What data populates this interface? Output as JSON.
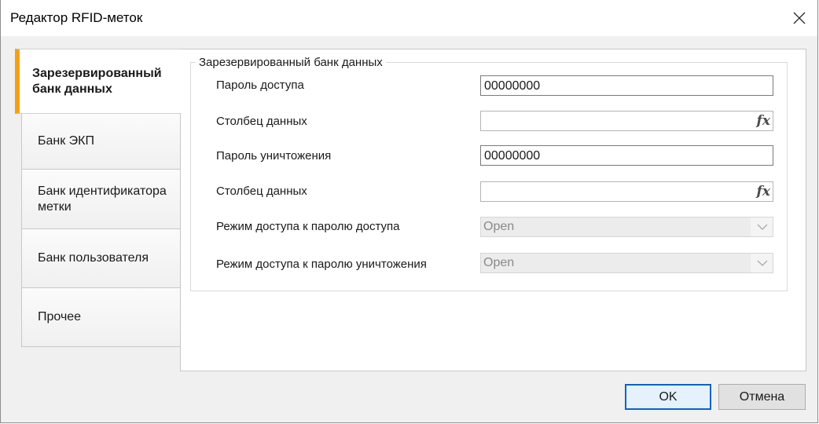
{
  "window": {
    "title": "Редактор RFID-меток"
  },
  "tabs": [
    {
      "label": "Зарезервированный банк данных",
      "active": true
    },
    {
      "label": "Банк ЭКП",
      "active": false
    },
    {
      "label": "Банк идентификатора метки",
      "active": false
    },
    {
      "label": "Банк пользователя",
      "active": false
    },
    {
      "label": "Прочее",
      "active": false
    }
  ],
  "group": {
    "title": "Зарезервированный банк данных",
    "rows": [
      {
        "label": "Пароль доступа",
        "value": "00000000"
      },
      {
        "label": "Столбец данных",
        "value": "",
        "icon": "fx-expression-icon"
      },
      {
        "label": "Пароль уничтожения",
        "value": "00000000"
      },
      {
        "label": "Столбец данных",
        "value": "",
        "icon": "fx-expression-icon"
      },
      {
        "label": "Режим доступа к паролю доступа",
        "value": "Open"
      },
      {
        "label": "Режим доступа к паролю уничтожения",
        "value": "Open"
      }
    ]
  },
  "icons": {
    "fx": "fx",
    "close": "close-icon",
    "dropdown": "chevron-down-icon"
  },
  "buttons": {
    "ok": "OK",
    "cancel": "Отмена"
  },
  "colors": {
    "active_tab_accent": "#f4a11a",
    "default_button_border": "#0a64c8"
  }
}
